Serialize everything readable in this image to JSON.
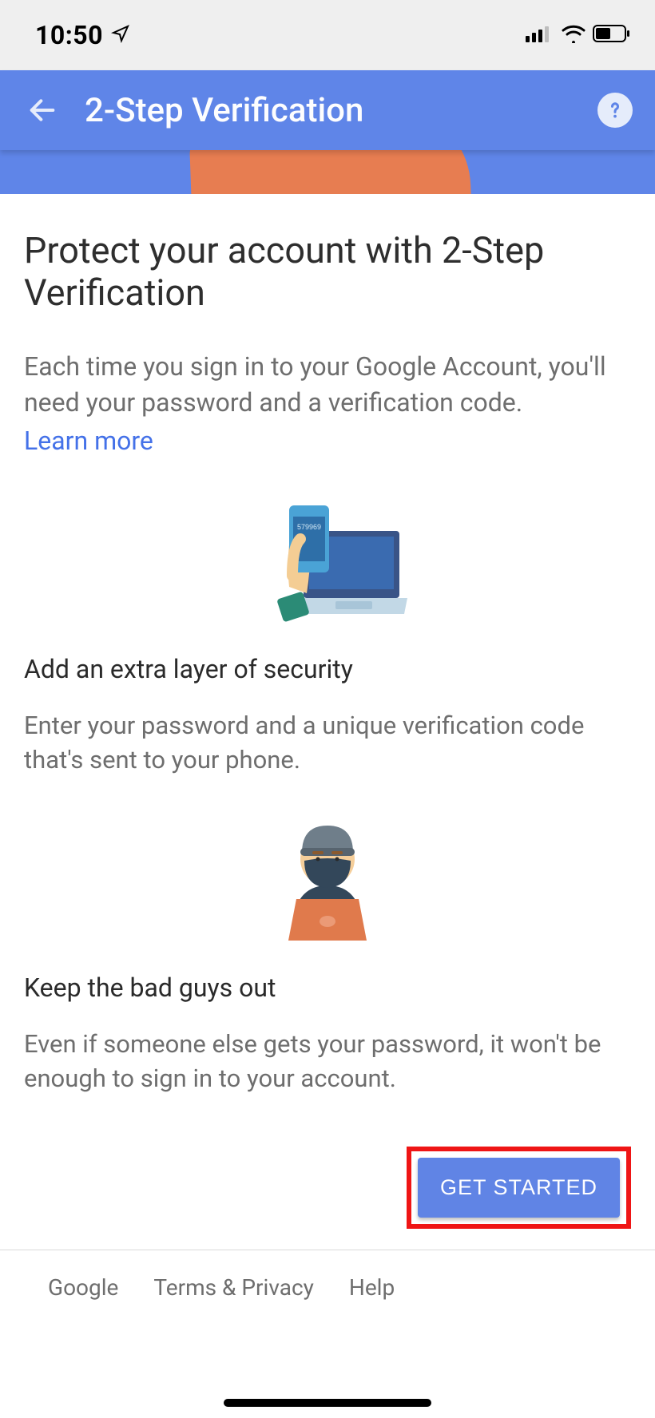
{
  "statusBar": {
    "time": "10:50"
  },
  "appBar": {
    "title": "2-Step Verification"
  },
  "main": {
    "title": "Protect your account with 2-Step Verification",
    "description": "Each time you sign in to your Google Account, you'll need your password and a verification code.",
    "learnMore": "Learn more",
    "section1": {
      "phoneCode": "579969",
      "title": "Add an extra layer of security",
      "description": "Enter your password and a unique verification code that's sent to your phone."
    },
    "section2": {
      "title": "Keep the bad guys out",
      "description": "Even if someone else gets your password, it won't be enough to sign in to your account."
    },
    "cta": "GET STARTED"
  },
  "footer": {
    "link1": "Google",
    "link2": "Terms & Privacy",
    "link3": "Help"
  }
}
